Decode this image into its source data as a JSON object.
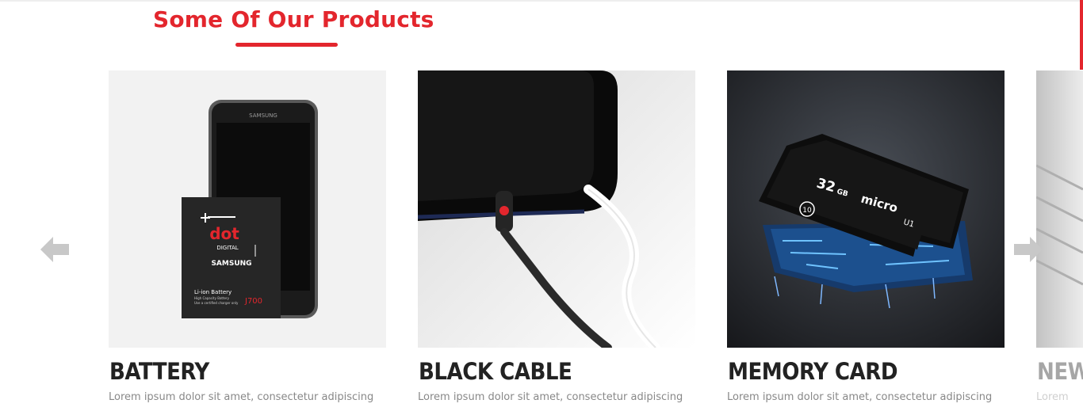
{
  "section": {
    "title": "Some Of Our Products"
  },
  "products": [
    {
      "name": "BATTERY",
      "description": "Lorem ipsum dolor sit amet, consectetur adipiscing",
      "image": {
        "phone_brand": "SAMSUNG",
        "battery_logo": "dot",
        "battery_logo_sub": "DIGITAL",
        "battery_brand": "SAMSUNG",
        "battery_type": "Li-ion Battery",
        "battery_line1": "High Capacity Battery",
        "battery_line2": "Use a certified charger only",
        "battery_model": "J700"
      }
    },
    {
      "name": "BLACK CABLE",
      "description": "Lorem ipsum dolor sit amet, consectetur adipiscing"
    },
    {
      "name": "MEMORY CARD",
      "description": "Lorem ipsum dolor sit amet, consectetur adipiscing",
      "image": {
        "capacity": "32",
        "capacity_unit": "GB",
        "brand": "micro",
        "class": "10",
        "uhs": "U1"
      }
    },
    {
      "name": "NEW",
      "description": "Lorem"
    }
  ],
  "navigation": {
    "prev_icon": "arrow-left-icon",
    "next_icon": "arrow-right-icon"
  },
  "colors": {
    "accent": "#e3262d",
    "heading": "#222222",
    "body_text": "#888888",
    "arrow": "#c8c8c8"
  }
}
